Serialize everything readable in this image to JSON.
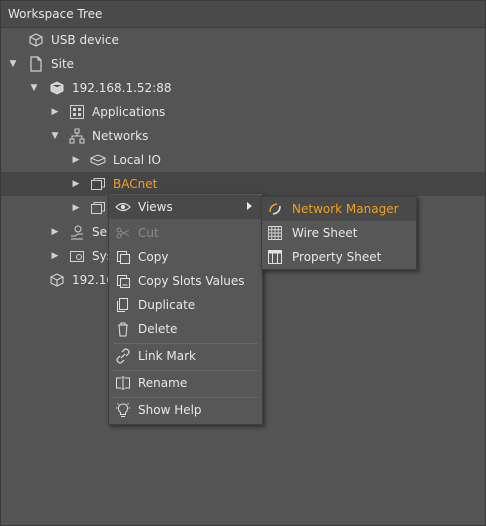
{
  "panel": {
    "title": "Workspace Tree"
  },
  "tree": [
    {
      "label": "USB device"
    },
    {
      "label": "Site"
    },
    {
      "label": "192.168.1.52:88"
    },
    {
      "label": "Applications"
    },
    {
      "label": "Networks"
    },
    {
      "label": "Local IO"
    },
    {
      "label": "BACnet"
    },
    {
      "label": ""
    },
    {
      "label": "Ser"
    },
    {
      "label": "Sys"
    },
    {
      "label": "192.16"
    }
  ],
  "context_menu": {
    "items": {
      "views": "Views",
      "cut": "Cut",
      "copy": "Copy",
      "copy_slots": "Copy Slots Values",
      "duplicate": "Duplicate",
      "delete": "Delete",
      "link_mark": "Link Mark",
      "rename": "Rename",
      "show_help": "Show Help"
    }
  },
  "views_submenu": {
    "network_manager": "Network Manager",
    "wire_sheet": "Wire Sheet",
    "property_sheet": "Property Sheet"
  },
  "colors": {
    "accent": "#f0a020",
    "background": "#545454"
  }
}
